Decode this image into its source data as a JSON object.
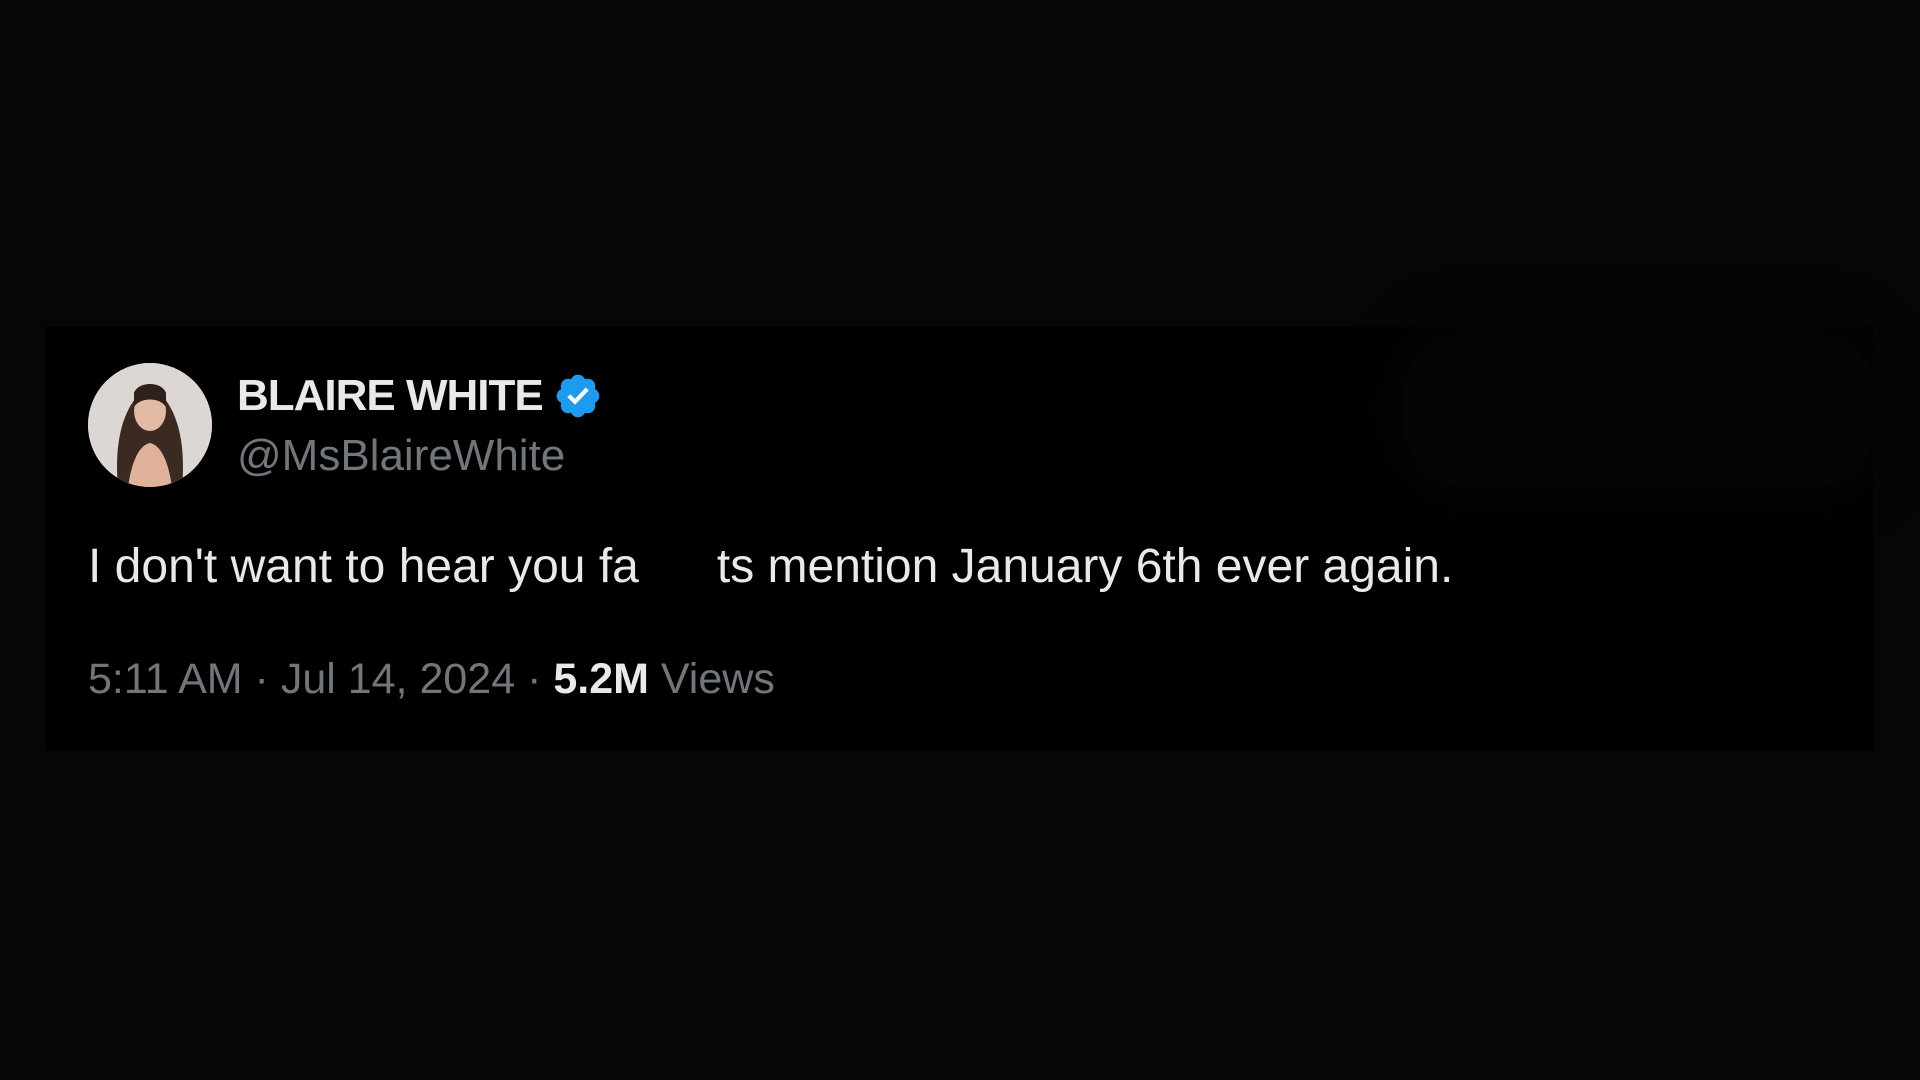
{
  "tweet": {
    "display_name": "BLAIRE WHITE",
    "handle": "@MsBlaireWhite",
    "text_before": "I don't want to hear you fa",
    "text_after": "ts mention January 6th ever again.",
    "time": "5:11 AM",
    "separator": "·",
    "date": "Jul 14, 2024",
    "views_count": "5.2M",
    "views_label": "Views",
    "verified_icon": "verified-badge-icon"
  },
  "colors": {
    "background": "#060606",
    "card": "#000000",
    "primary_text": "#e7e9ea",
    "secondary_text": "#71767b",
    "verified_blue": "#1d9bf0"
  }
}
